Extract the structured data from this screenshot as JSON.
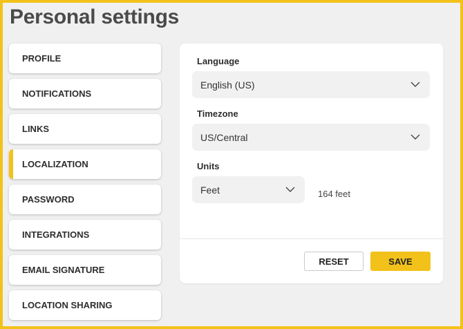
{
  "page": {
    "title": "Personal settings"
  },
  "sidebar": {
    "items": [
      {
        "label": "PROFILE",
        "active": false
      },
      {
        "label": "NOTIFICATIONS",
        "active": false
      },
      {
        "label": "LINKS",
        "active": false
      },
      {
        "label": "LOCALIZATION",
        "active": true
      },
      {
        "label": "PASSWORD",
        "active": false
      },
      {
        "label": "INTEGRATIONS",
        "active": false
      },
      {
        "label": "EMAIL SIGNATURE",
        "active": false
      },
      {
        "label": "LOCATION SHARING",
        "active": false
      }
    ]
  },
  "form": {
    "language": {
      "label": "Language",
      "value": "English (US)"
    },
    "timezone": {
      "label": "Timezone",
      "value": "US/Central"
    },
    "units": {
      "label": "Units",
      "value": "Feet",
      "note": "164 feet"
    }
  },
  "actions": {
    "reset_label": "RESET",
    "save_label": "SAVE"
  },
  "colors": {
    "accent": "#f2c21b",
    "frame": "#f2c21b",
    "background": "#f0f0f0"
  },
  "icons": {
    "dropdown": "chevron-down-icon"
  }
}
